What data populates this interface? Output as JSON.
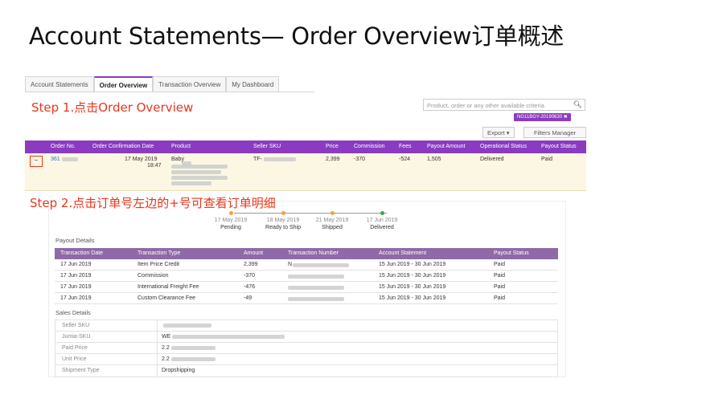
{
  "slide_title": "Account Statements— Order Overview订单概述",
  "tabs": [
    "Account Statements",
    "Order Overview",
    "Transaction Overview",
    "My Dashboard"
  ],
  "step1": "Step 1.点击Order Overview",
  "step2": "Step  2.点击订单号左边的+号可查看订单明细",
  "search": {
    "placeholder": "Product, order or any other available criteria",
    "filter_chip": "NG11BGY-20190630 ✖"
  },
  "buttons": {
    "export": "Export ▾",
    "filters": "Filters Manager"
  },
  "order_table": {
    "headers": [
      "Order No.",
      "Order Confirmation Date",
      "Product",
      "Seller SKU",
      "Price",
      "Commission",
      "Fees",
      "Payout Amount",
      "Operational Status",
      "Payout Status"
    ],
    "row": {
      "toggle": "−",
      "order_no": "361",
      "date": "17 May 2019",
      "time": "18:47",
      "product": "Baby",
      "seller_sku": "TF-",
      "price": "2,399",
      "commission": "-370",
      "fees": "-524",
      "payout_amount": "1,505",
      "operational_status": "Delivered",
      "payout_status": "Paid"
    }
  },
  "timeline": [
    {
      "date": "17 May 2019",
      "label": "Pending",
      "color": "#f2a23a"
    },
    {
      "date": "18 May 2019",
      "label": "Ready to Ship",
      "color": "#f2a23a"
    },
    {
      "date": "21 May 2019",
      "label": "Shipped",
      "color": "#f2a23a"
    },
    {
      "date": "17 Jun 2019",
      "label": "Delivered",
      "color": "#3aa655"
    }
  ],
  "payout_details": {
    "title": "Payout Details",
    "headers": [
      "Transaction Date",
      "Transaction Type",
      "Amount",
      "Transaction Number",
      "Account Statement",
      "Payout Status"
    ],
    "rows": [
      [
        "17 Jun 2019",
        "Item Price Credit",
        "2,399",
        "N",
        "15 Jun 2019 - 30 Jun 2019",
        "Paid"
      ],
      [
        "17 Jun 2019",
        "Commission",
        "-370",
        "",
        "15 Jun 2019 - 30 Jun 2019",
        "Paid"
      ],
      [
        "17 Jun 2019",
        "International Freight Fee",
        "-476",
        "",
        "15 Jun 2019 - 30 Jun 2019",
        "Paid"
      ],
      [
        "17 Jun 2019",
        "Custom Clearance Fee",
        "-49",
        "",
        "15 Jun 2019 - 30 Jun 2019",
        "Paid"
      ]
    ]
  },
  "sales_details": {
    "title": "Sales Details",
    "rows": [
      [
        "Seller SKU",
        ""
      ],
      [
        "Jumia-SKU",
        "WE"
      ],
      [
        "Paid Price",
        "2.2"
      ],
      [
        "Unit Price",
        "2.2"
      ],
      [
        "Shipment Type",
        "Dropshipping"
      ]
    ]
  },
  "colors": {
    "accent": "#8a3bbf",
    "step_text": "#e8371e",
    "row_highlight": "#fbf7e3"
  }
}
